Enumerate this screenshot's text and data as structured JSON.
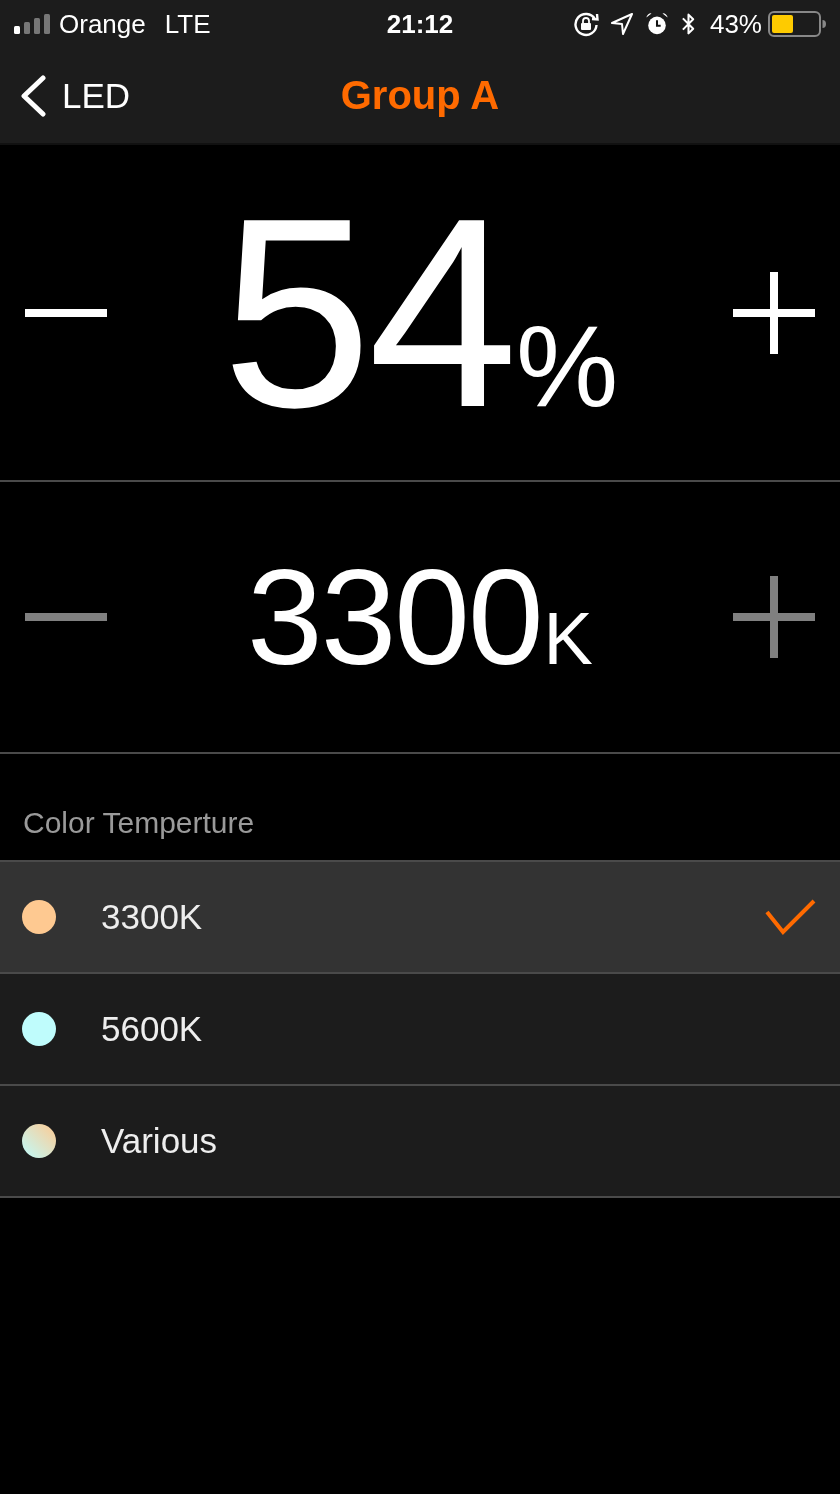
{
  "status_bar": {
    "carrier": "Orange",
    "network": "LTE",
    "time": "21:12",
    "battery": "43%"
  },
  "nav": {
    "back": "LED",
    "title": "Group A"
  },
  "brightness": {
    "value": "54",
    "unit": "%",
    "decrease": {
      "disabled": false
    },
    "increase": {
      "disabled": false
    }
  },
  "temperature": {
    "value": "3300",
    "unit": "K",
    "decrease": {
      "disabled": true
    },
    "increase": {
      "disabled": true
    }
  },
  "color_temperature": {
    "header": "Color Temperture",
    "items": [
      {
        "label": "3300K",
        "kind": "solid",
        "color": "#fec991",
        "selected": true
      },
      {
        "label": "5600K",
        "kind": "solid",
        "color": "#bffcfc",
        "selected": false
      },
      {
        "label": "Various",
        "kind": "mixed",
        "selected": false
      }
    ]
  }
}
